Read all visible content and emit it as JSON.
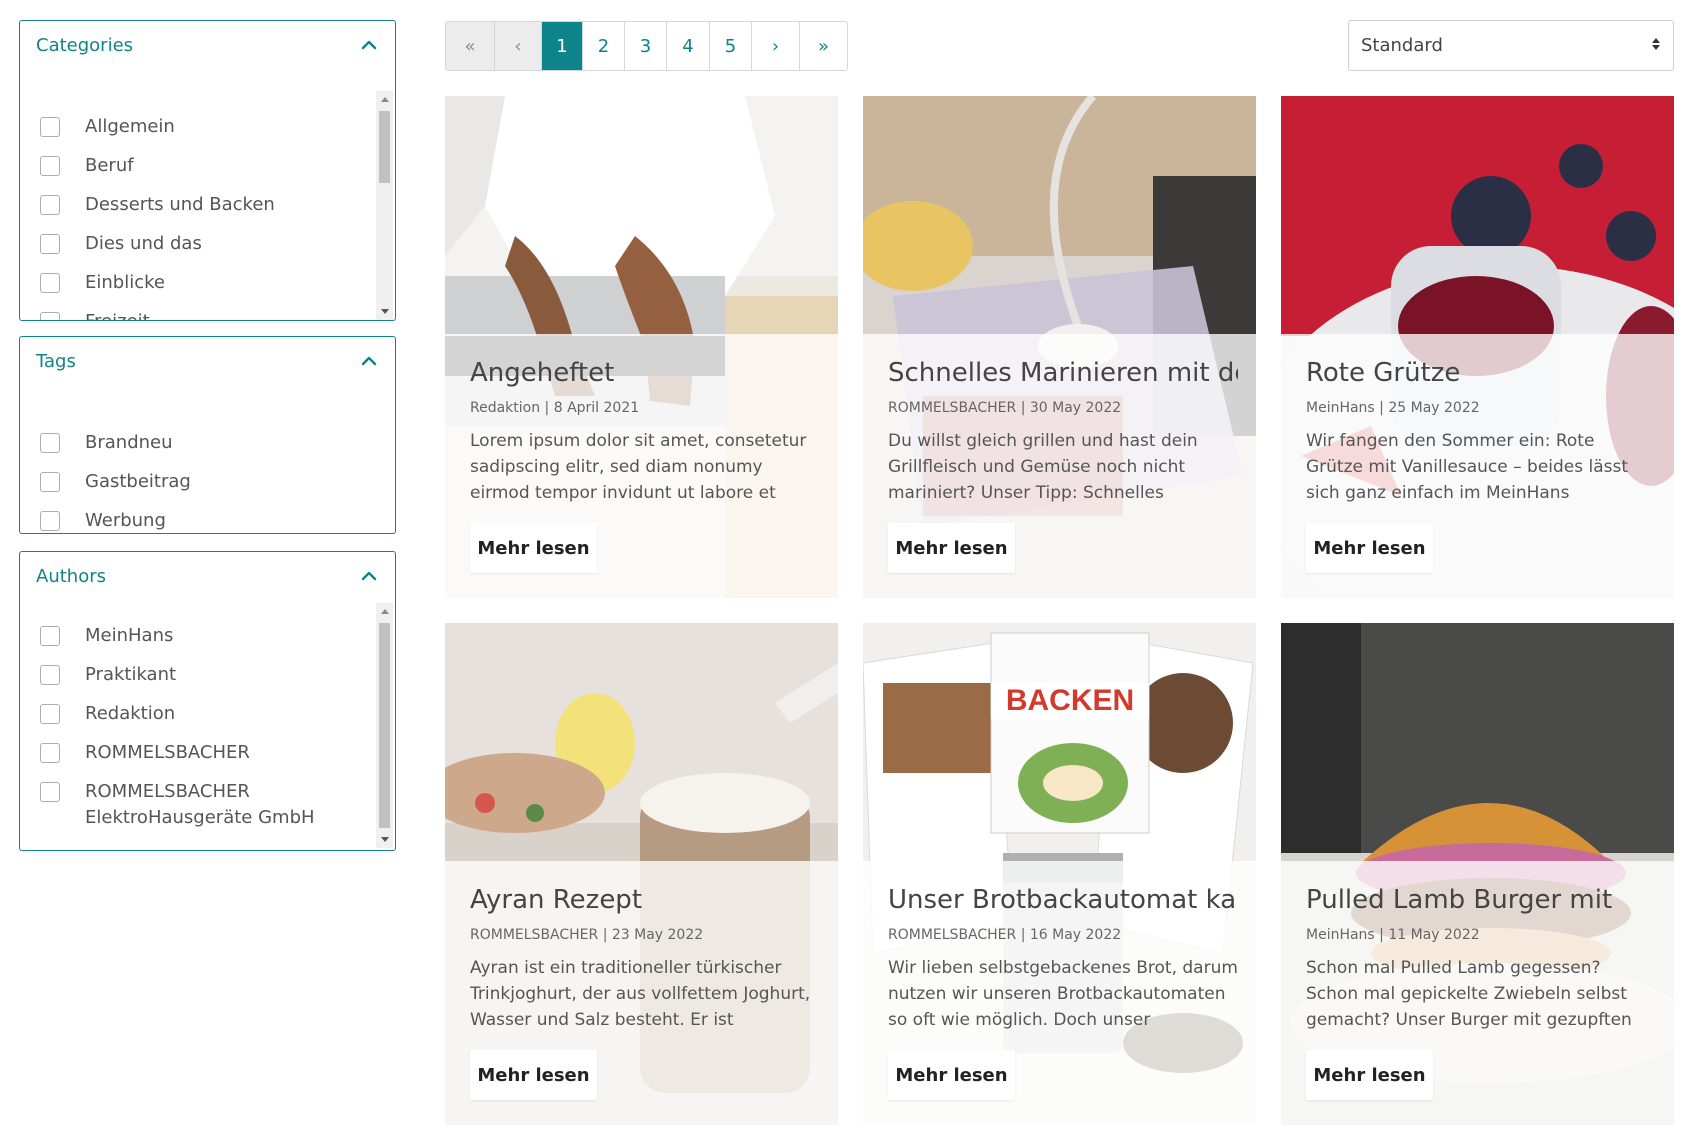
{
  "filters": {
    "categories": {
      "title": "Categories",
      "items": [
        "Allgemein",
        "Beruf",
        "Desserts und Backen",
        "Dies und das",
        "Einblicke",
        "Freizeit"
      ]
    },
    "tags": {
      "title": "Tags",
      "items": [
        "Brandneu",
        "Gastbeitrag",
        "Werbung"
      ]
    },
    "authors": {
      "title": "Authors",
      "items": [
        "MeinHans",
        "Praktikant",
        "Redaktion",
        "ROMMELSBACHER",
        "ROMMELSBACHER\nElektroHausgeräte GmbH"
      ]
    }
  },
  "pagination": {
    "first": "«",
    "prev": "‹",
    "pages": [
      "1",
      "2",
      "3",
      "4",
      "5"
    ],
    "active_page": "1",
    "next": "›",
    "last": "»"
  },
  "sort": {
    "value": "Standard"
  },
  "colors": {
    "accent": "#0d8489"
  },
  "cards": [
    {
      "title": "Angeheftet",
      "meta": "Redaktion | 8 April 2021",
      "excerpt": "Lorem ipsum dolor sit amet, consetetur sadipscing elitr, sed diam nonumy eirmod tempor invidunt ut labore et",
      "button": "Mehr lesen",
      "image": "laptop-typing-photo"
    },
    {
      "title": "Schnelles Marinieren mit dem",
      "meta": "ROMMELSBACHER | 30 May 2022",
      "excerpt": "Du willst gleich grillen und hast dein Grillfleisch und Gemüse noch nicht mariniert? Unser Tipp: Schnelles",
      "button": "Mehr lesen",
      "image": "vacuum-container-photo"
    },
    {
      "title": "Rote Grütze",
      "meta": "MeinHans | 25 May 2022",
      "excerpt": "Wir fangen den Sommer ein: Rote Grütze mit Vanillesauce – beides lässt sich ganz einfach im MeinHans Multikocher",
      "button": "Mehr lesen",
      "image": "berry-jar-photo"
    },
    {
      "title": "Ayran Rezept",
      "meta": "ROMMELSBACHER | 23 May 2022",
      "excerpt": "Ayran ist ein traditioneller türkischer Trinkjoghurt, der aus vollfettem Joghurt, Wasser und Salz besteht. Er ist",
      "button": "Mehr lesen",
      "image": "ayran-cup-photo"
    },
    {
      "title": "Unser Brotbackautomat kann",
      "meta": "ROMMELSBACHER | 16 May 2022",
      "excerpt": "Wir lieben selbstgebackenes Brot, darum nutzen wir unseren Brotbackautomaten so oft wie möglich. Doch unser",
      "button": "Mehr lesen",
      "image": "baking-booklet-photo",
      "booklet_title": "BACKEN"
    },
    {
      "title": "Pulled Lamb Burger mit",
      "meta": "MeinHans | 11 May 2022",
      "excerpt": "Schon mal Pulled Lamb gegessen? Schon mal gepickelte Zwiebeln selbst gemacht? Unser Burger mit gezupften",
      "button": "Mehr lesen",
      "image": "burger-photo"
    }
  ]
}
